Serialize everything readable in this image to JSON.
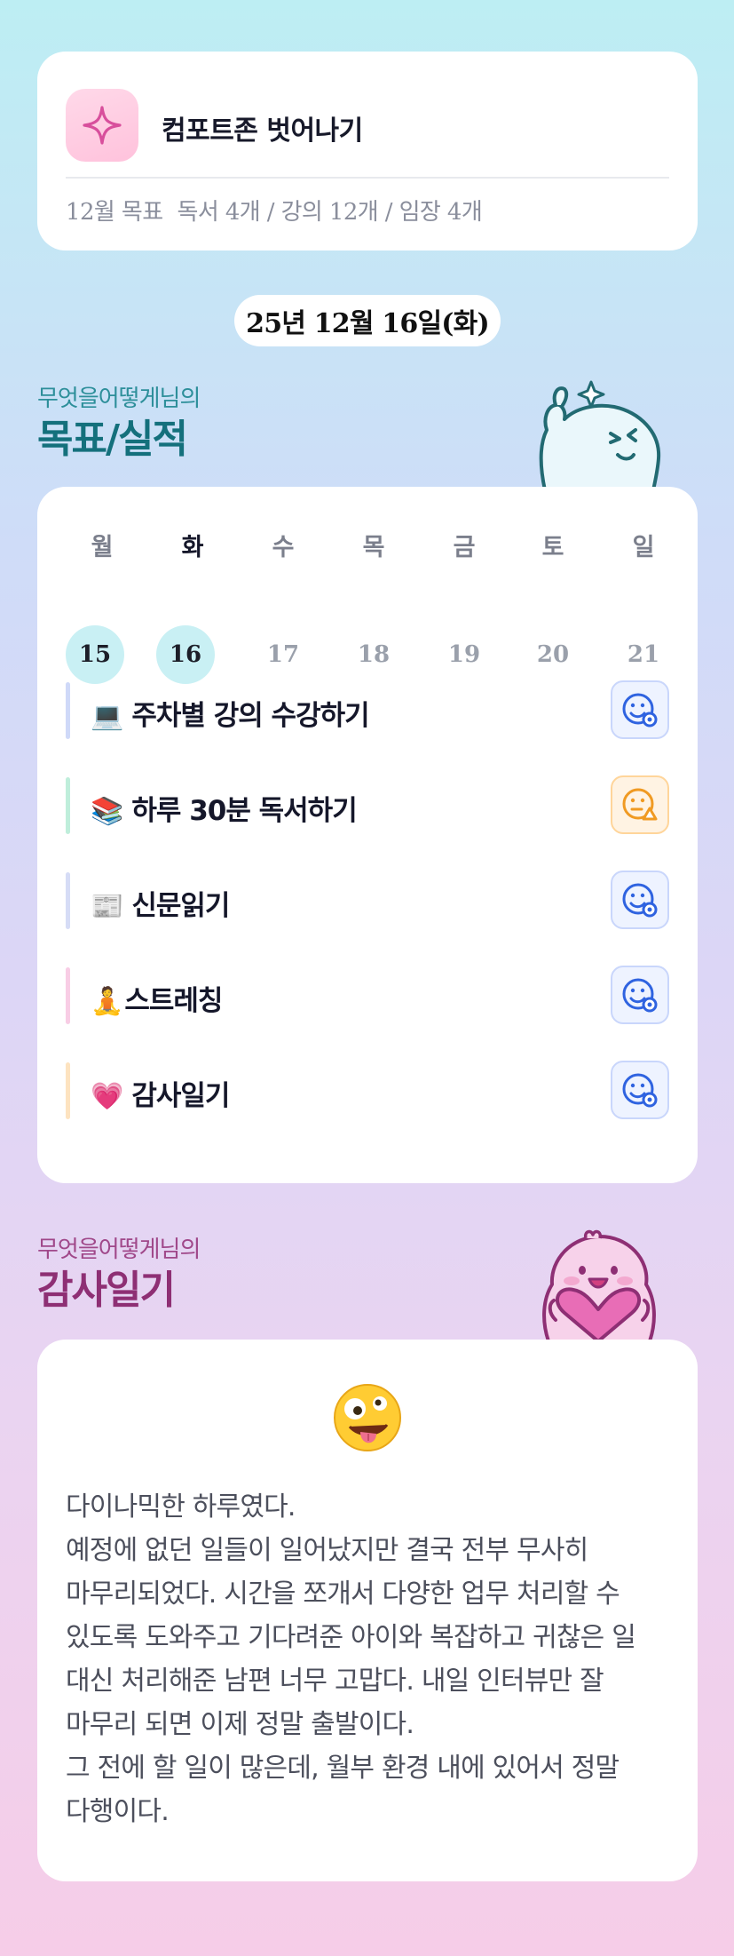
{
  "goal": {
    "title": "컴포트존 벗어나기",
    "month_label": "12월 목표",
    "stats": "독서 4개 / 강의 12개 / 임장 4개"
  },
  "date": "25년 12월 16일(화)",
  "goals_section": {
    "subtitle": "무엇을어떻게님의",
    "title": "목표/실적"
  },
  "calendar": {
    "weekdays": [
      "월",
      "화",
      "수",
      "목",
      "금",
      "토",
      "일"
    ],
    "days": [
      "15",
      "16",
      "17",
      "18",
      "19",
      "20",
      "21"
    ],
    "completed_days": [
      "15",
      "16"
    ],
    "selected_weekday": "화"
  },
  "tasks": [
    {
      "emoji": "💻",
      "label": "주차별 강의 수강하기",
      "bar_color": "#cfd9f8",
      "status": "smile-check-icon"
    },
    {
      "emoji": "📚",
      "label": "하루 30분 독서하기",
      "bar_color": "#bfeedb",
      "status": "neutral-warning-icon"
    },
    {
      "emoji": "📰",
      "label": "신문읽기",
      "bar_color": "#d6dcf6",
      "status": "smile-check-icon"
    },
    {
      "emoji": "🧘",
      "label": "스트레칭",
      "bar_color": "#f8cde5",
      "status": "smile-check-icon"
    },
    {
      "emoji": "💗",
      "label": "감사일기",
      "bar_color": "#fde3c0",
      "status": "smile-check-icon"
    }
  ],
  "diary_section": {
    "subtitle": "무엇을어떻게님의",
    "title": "감사일기"
  },
  "diary": {
    "mood_emoji": "🤪",
    "paragraphs": [
      "다이나믹한 하루였다.",
      "예정에 없던 일들이 일어났지만 결국 전부 무사히 마무리되었다. 시간을 쪼개서 다양한 업무 처리할 수 있도록 도와주고 기다려준 아이와 복잡하고 귀찮은 일 대신 처리해준 남편 너무 고맙다. 내일 인터뷰만 잘 마무리 되면 이제 정말 출발이다.",
      "그 전에 할 일이 많은데, 월부 환경 내에 있어서 정말 다행이다."
    ]
  },
  "colors": {
    "goal_accent": "#d84f9c",
    "status_good": "#2f63e0",
    "status_warn": "#f09a22",
    "done_day_bg": "#c9f0f4"
  }
}
